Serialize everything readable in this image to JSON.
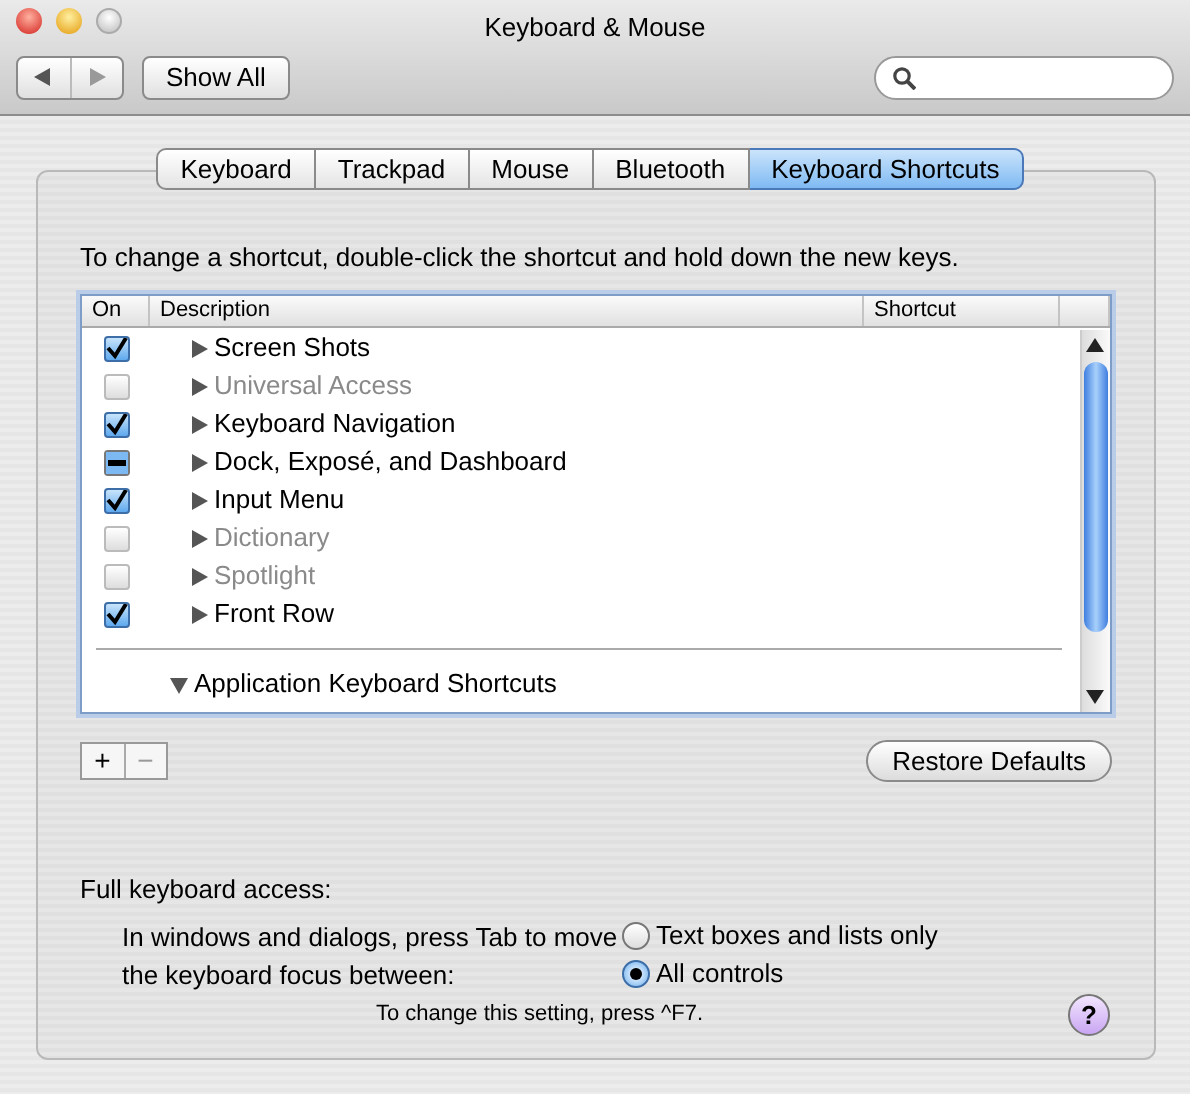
{
  "window": {
    "title": "Keyboard & Mouse"
  },
  "toolbar": {
    "show_all": "Show All"
  },
  "tabs": [
    {
      "label": "Keyboard",
      "selected": false
    },
    {
      "label": "Trackpad",
      "selected": false
    },
    {
      "label": "Mouse",
      "selected": false
    },
    {
      "label": "Bluetooth",
      "selected": false
    },
    {
      "label": "Keyboard Shortcuts",
      "selected": true
    }
  ],
  "instruction": "To change a shortcut, double-click the shortcut and hold down the new keys.",
  "table": {
    "columns": [
      "On",
      "Description",
      "Shortcut"
    ],
    "rows": [
      {
        "checked": true,
        "mixed": false,
        "disabled": false,
        "expanded": false,
        "description": "Screen Shots"
      },
      {
        "checked": false,
        "mixed": false,
        "disabled": true,
        "expanded": false,
        "description": "Universal Access"
      },
      {
        "checked": true,
        "mixed": false,
        "disabled": false,
        "expanded": false,
        "description": "Keyboard Navigation"
      },
      {
        "checked": false,
        "mixed": true,
        "disabled": false,
        "expanded": false,
        "description": "Dock, Exposé, and Dashboard"
      },
      {
        "checked": true,
        "mixed": false,
        "disabled": false,
        "expanded": false,
        "description": "Input Menu"
      },
      {
        "checked": false,
        "mixed": false,
        "disabled": true,
        "expanded": false,
        "description": "Dictionary"
      },
      {
        "checked": false,
        "mixed": false,
        "disabled": true,
        "expanded": false,
        "description": "Spotlight"
      },
      {
        "checked": true,
        "mixed": false,
        "disabled": false,
        "expanded": false,
        "description": "Front Row"
      }
    ],
    "app_section": {
      "expanded": true,
      "description": "Application Keyboard Shortcuts"
    }
  },
  "add_button": "+",
  "remove_button": "−",
  "restore_defaults": "Restore Defaults",
  "keyboard_access": {
    "heading": "Full keyboard access:",
    "text": "In windows and dialogs, press Tab to move the keyboard focus between:",
    "options": [
      {
        "label": "Text boxes and lists only",
        "selected": false
      },
      {
        "label": "All controls",
        "selected": true
      }
    ],
    "note": "To change this setting, press ^F7."
  },
  "help_button": "?"
}
